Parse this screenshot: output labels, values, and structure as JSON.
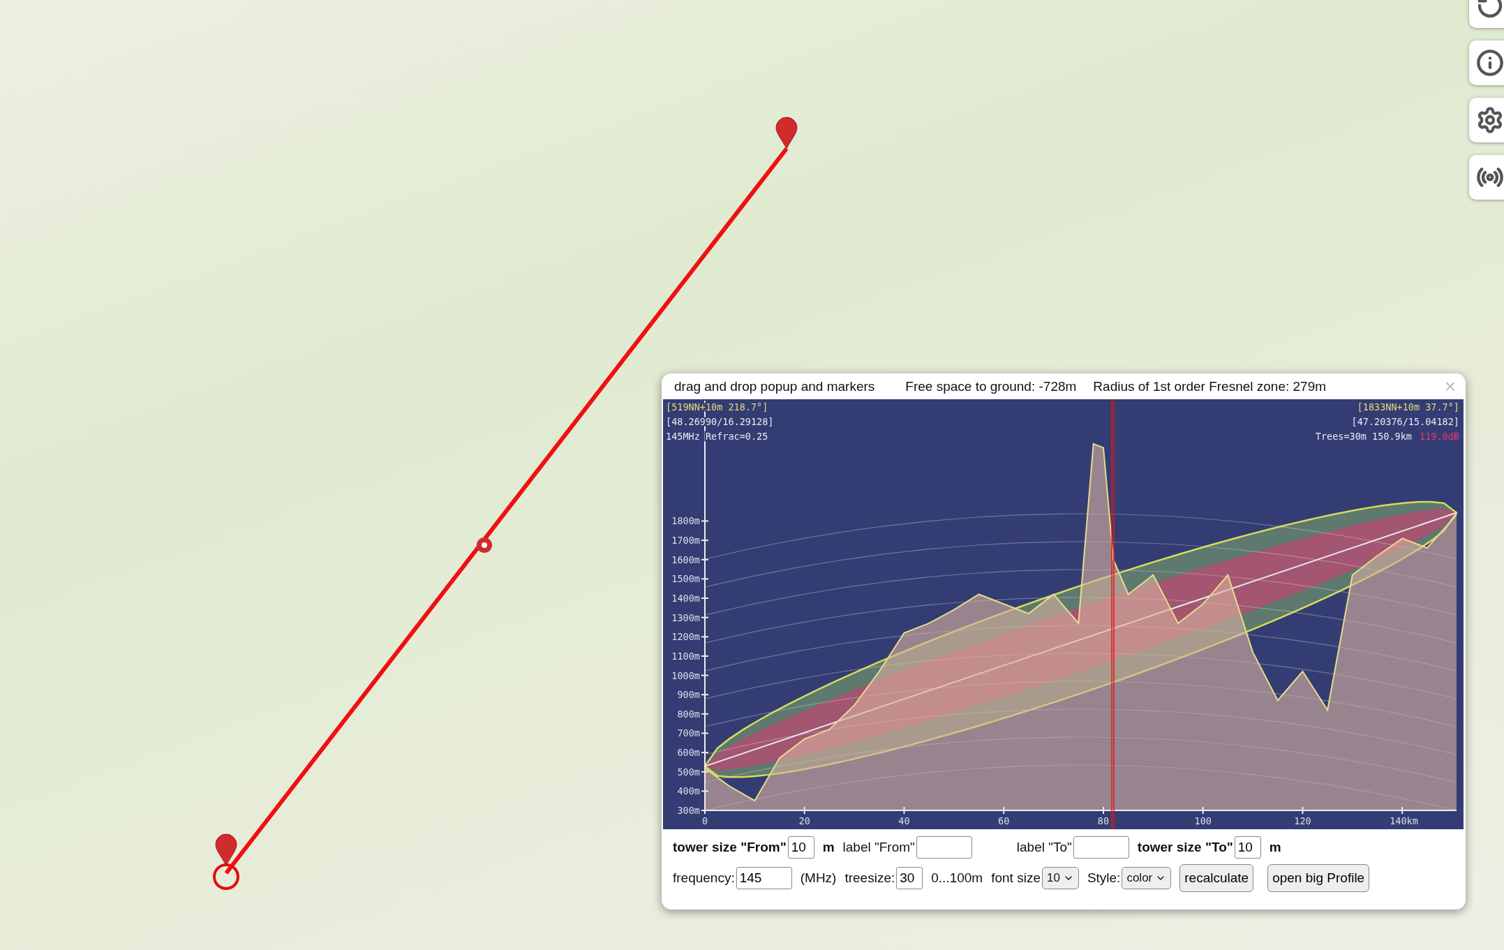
{
  "map": {
    "route": {
      "markers": [
        {
          "kind": "pin"
        },
        {
          "kind": "midpoint"
        },
        {
          "kind": "pin"
        }
      ]
    }
  },
  "map_controls": [
    {
      "kind": "rotate"
    },
    {
      "kind": "info"
    },
    {
      "kind": "settings"
    },
    {
      "kind": "antenna"
    }
  ],
  "popup": {
    "title": "drag and drop popup and markers",
    "free_space": "Free space to ground: -728m",
    "fresnel_radius": "Radius of 1st order Fresnel zone: 279m",
    "close": "×",
    "info_left": [
      "[519NN+10m 218.7°]",
      "[48.26990/16.29128]",
      "145MHz Refrac=0.25"
    ],
    "info_right": [
      "[1833NN+10m 37.7°]",
      "[47.20376/15.04182]"
    ],
    "info_right_last": {
      "text": "Trees=30m 150.9km",
      "loss": "119.0dB"
    },
    "chart_data": {
      "type": "area",
      "x": [
        0,
        5,
        10,
        15,
        20,
        25,
        30,
        35,
        40,
        45,
        50,
        55,
        60,
        65,
        70,
        75,
        78,
        80,
        82,
        85,
        90,
        95,
        100,
        105,
        110,
        115,
        120,
        125,
        130,
        135,
        140,
        145,
        150.9
      ],
      "values": [
        519,
        424,
        350,
        572,
        670,
        720,
        845,
        1020,
        1220,
        1270,
        1340,
        1420,
        1370,
        1320,
        1420,
        1270,
        2200,
        2180,
        1600,
        1420,
        1520,
        1270,
        1370,
        1520,
        1120,
        870,
        1020,
        820,
        1520,
        1620,
        1710,
        1660,
        1833
      ],
      "xticks": [
        0,
        20,
        40,
        60,
        80,
        100,
        120,
        {
          "value": 140,
          "label": "140km"
        }
      ],
      "xlim": [
        0,
        150.9
      ],
      "ylim": [
        300,
        2424
      ],
      "yticks": [
        {
          "value": 300,
          "label": "300m"
        },
        {
          "value": 400,
          "label": "400m"
        },
        {
          "value": 500,
          "label": "500m"
        },
        {
          "value": 600,
          "label": "600m"
        },
        {
          "value": 700,
          "label": "700m"
        },
        {
          "value": 800,
          "label": "800m"
        },
        {
          "value": 900,
          "label": "900m"
        },
        {
          "value": 1000,
          "label": "1000m"
        },
        {
          "value": 1100,
          "label": "1100m"
        },
        {
          "value": 1200,
          "label": "1200m"
        },
        {
          "value": 1300,
          "label": "1300m"
        },
        {
          "value": 1400,
          "label": "1400m"
        },
        {
          "value": 1500,
          "label": "1500m"
        },
        {
          "value": 1600,
          "label": "1600m"
        },
        {
          "value": 1700,
          "label": "1700m"
        },
        {
          "value": 1800,
          "label": "1800m"
        }
      ]
    },
    "controls": [
      [
        {
          "kind": "bold_label",
          "text": "tower size \"From\""
        },
        {
          "kind": "short_input",
          "value": "10"
        },
        {
          "kind": "bold_label",
          "text": "m"
        },
        {
          "kind": "label",
          "text": "label \"From\""
        },
        {
          "kind": "input"
        },
        {
          "kind": "spacer"
        },
        {
          "kind": "label",
          "text": "label \"To\""
        },
        {
          "kind": "input"
        },
        {
          "kind": "bold_label",
          "text": "tower size \"To\""
        },
        {
          "kind": "short_input",
          "value": "10"
        },
        {
          "kind": "bold_label",
          "text": "m"
        }
      ],
      [
        {
          "kind": "label",
          "text": "frequency:"
        },
        {
          "kind": "input",
          "value": "145"
        },
        {
          "kind": "label",
          "text": "(MHz)"
        },
        {
          "kind": "label",
          "text": "treesize:"
        },
        {
          "kind": "short_input",
          "value": "30"
        },
        {
          "kind": "label",
          "text": "0...100m"
        },
        {
          "kind": "label",
          "text": "font size"
        },
        {
          "kind": "select",
          "value": "10"
        },
        {
          "kind": "label",
          "text": "Style:"
        },
        {
          "kind": "select",
          "value": "color"
        },
        {
          "kind": "button",
          "text": "recalculate"
        },
        {
          "kind": "button",
          "text": "open big Profile"
        }
      ]
    ]
  }
}
